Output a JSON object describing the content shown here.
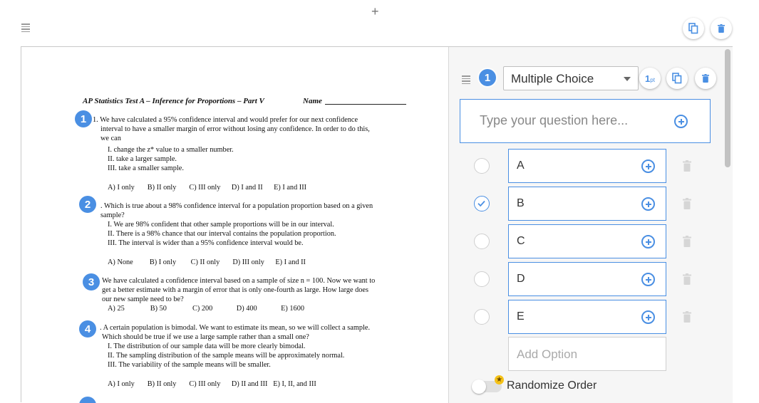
{
  "toolbar": {
    "add_label": "+"
  },
  "document": {
    "header": "AP Statistics Test A – Inference for Proportions – Part V",
    "name_label": "Name",
    "badges": [
      "1",
      "2",
      "3",
      "4"
    ],
    "lines": {
      "q1a": "1. We have calculated a 95% confidence interval and would prefer for our next confidence",
      "q1b": "interval to have a smaller margin of error without losing any confidence. In order to do this,",
      "q1c": "we can",
      "q1i": "I.   change the z* value to a smaller number.",
      "q1ii": "II.  take a larger sample.",
      "q1iii": "III. take a smaller sample.",
      "q1ans": "A) I only       B) II only       C) III only      D) I and II      E) I and III",
      "q2a": ". Which is true about a 98% confidence interval for a population proportion based on a given",
      "q2b": "sample?",
      "q2i": "I.   We are 98% confident that other sample proportions will be in our interval.",
      "q2ii": "II.  There is a 98% chance that our interval contains the population proportion.",
      "q2iii": "III. The interval is wider than a 95% confidence interval would be.",
      "q2ans": "A) None         B) I only        C) II only       D) III only      E) I and II",
      "q3a": "We have calculated a confidence interval based on a sample of size n = 100. Now we want to",
      "q3b": "get a better estimate with a margin of error that is only one-fourth as large. How large does",
      "q3c": "our new sample need to be?",
      "q3ans": "A) 25              B) 50              C) 200             D) 400             E) 1600",
      "q4a": ". A certain population is bimodal. We want to estimate its mean, so we will collect a sample.",
      "q4b": "Which should be true if we use a large sample rather than a small one?",
      "q4i": "I.   The distribution of our sample data will be more clearly bimodal.",
      "q4ii": "II.  The sampling distribution of the sample means will be approximately normal.",
      "q4iii": "III. The variability of the sample means will be smaller.",
      "q4ans": "A) I only       B) II only       C) III only      D) II and III   E) I, II, and III"
    }
  },
  "question": {
    "number": "1",
    "type": "Multiple Choice",
    "points": "1",
    "points_unit": "pt",
    "placeholder": "Type your question here...",
    "options": [
      {
        "label": "A",
        "checked": false
      },
      {
        "label": "B",
        "checked": true
      },
      {
        "label": "C",
        "checked": false
      },
      {
        "label": "D",
        "checked": false
      },
      {
        "label": "E",
        "checked": false
      }
    ],
    "add_option_placeholder": "Add Option",
    "randomize_label": "Randomize Order",
    "randomize_on": false
  },
  "colors": {
    "accent": "#4a8fe3",
    "border": "#c9c9c9",
    "panel_bg": "#f6f6f6"
  },
  "icons": [
    "plus-icon",
    "drag-handle-icon",
    "copy-icon",
    "trash-icon",
    "add-circle-icon",
    "checkmark-icon",
    "star-icon",
    "chevron-down-icon"
  ]
}
